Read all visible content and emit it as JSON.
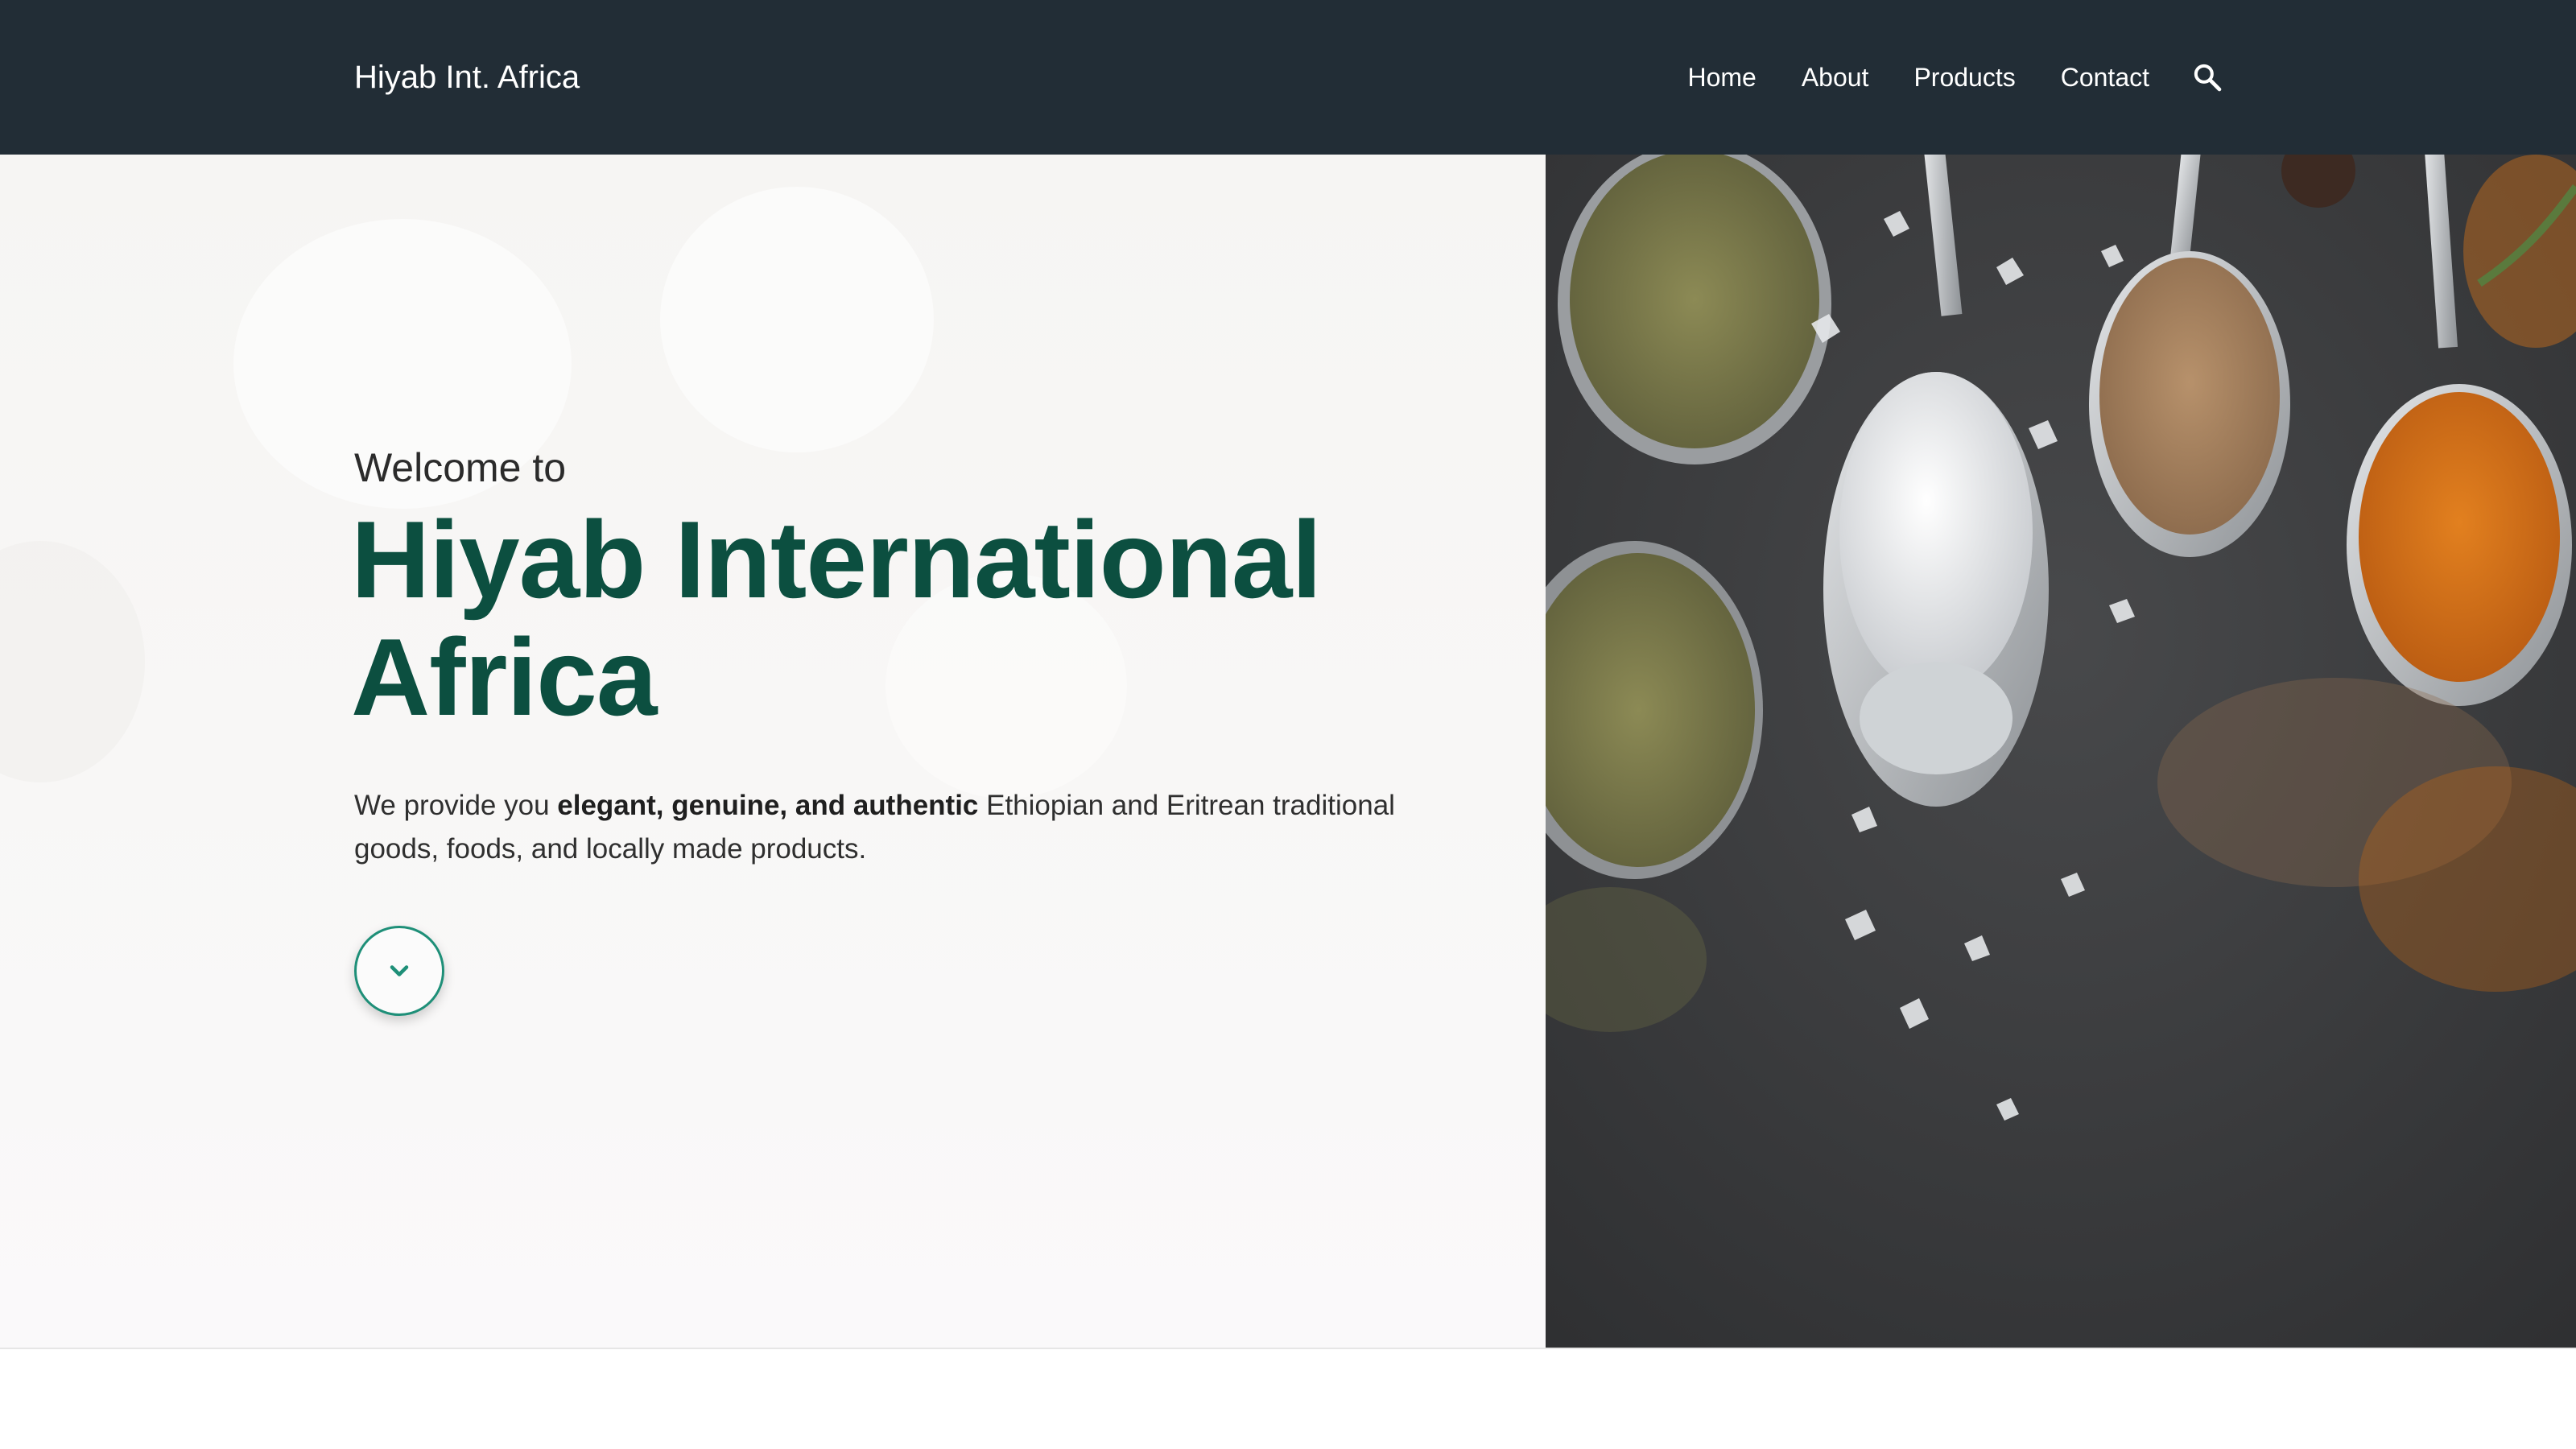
{
  "header": {
    "brand": "Hiyab Int. Africa",
    "nav": [
      {
        "label": "Home"
      },
      {
        "label": "About"
      },
      {
        "label": "Products"
      },
      {
        "label": "Contact"
      }
    ],
    "search_icon": "search-icon",
    "background_color": "#222d36"
  },
  "hero": {
    "welcome": "Welcome to",
    "title": "Hiyab International Africa",
    "description": {
      "before": "We provide you ",
      "highlight": "elegant, genuine, and authentic",
      "after": " Ethiopian and Eritrean traditional goods, foods, and locally made products."
    },
    "scroll_icon": "chevron-down-icon",
    "title_color": "#0c4f40",
    "accent_color": "#1e8f78",
    "image": "spices-in-spoons"
  }
}
